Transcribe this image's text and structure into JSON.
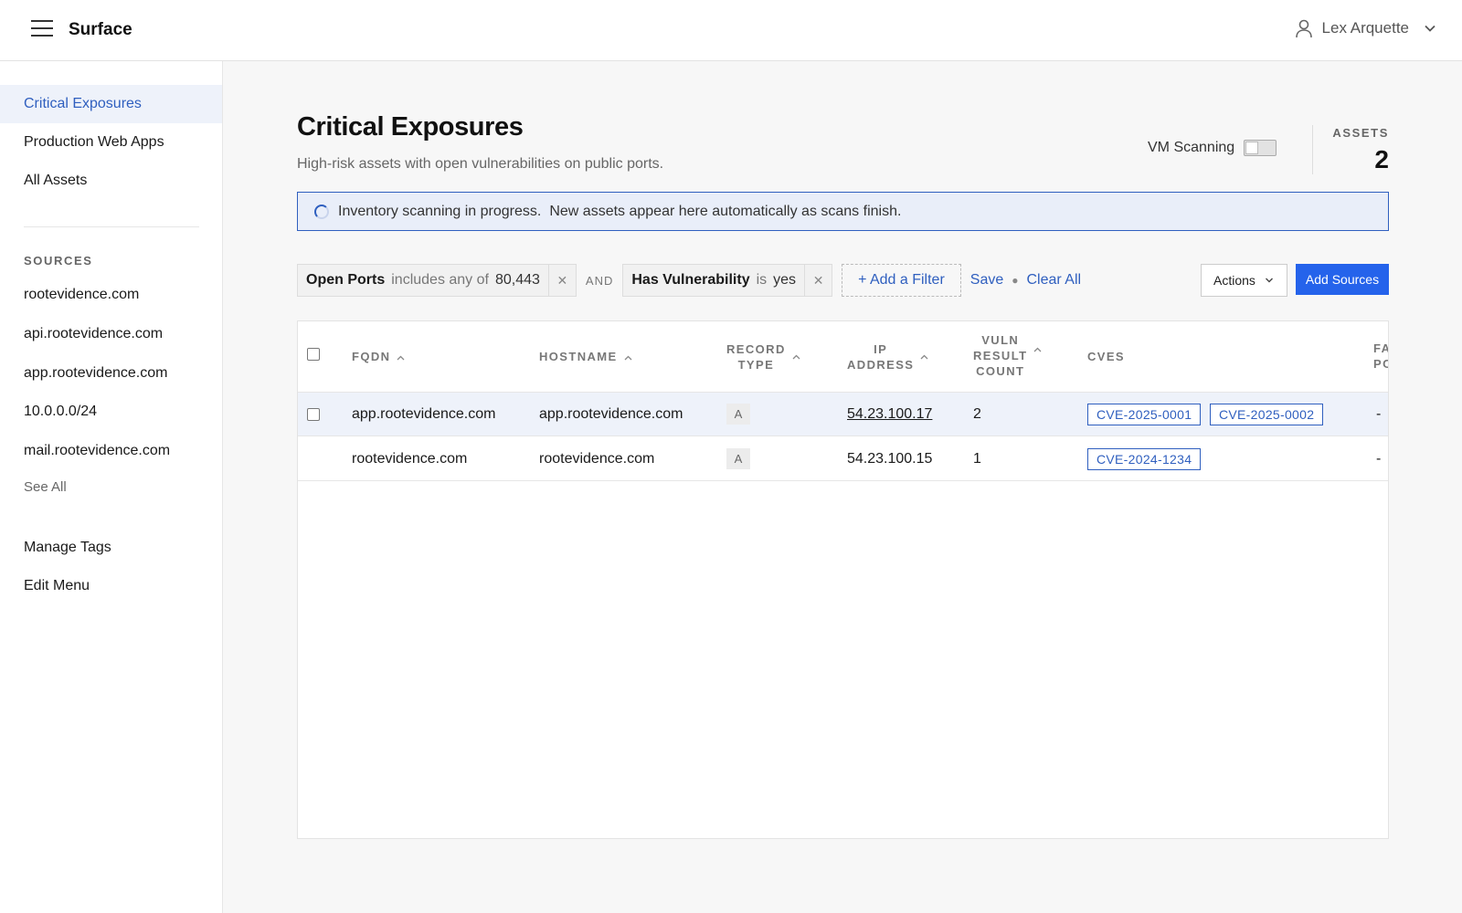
{
  "app": {
    "title": "Surface",
    "user_name": "Lex Arquette"
  },
  "sidebar": {
    "views": [
      {
        "label": "Critical Exposures",
        "active": true
      },
      {
        "label": "Production Web Apps",
        "active": false
      },
      {
        "label": "All Assets",
        "active": false
      }
    ],
    "sources_heading": "SOURCES",
    "sources": [
      "rootevidence.com",
      "api.rootevidence.com",
      "app.rootevidence.com",
      "10.0.0.0/24",
      "mail.rootevidence.com"
    ],
    "see_all": "See All",
    "footer": [
      "Manage Tags",
      "Edit Menu"
    ]
  },
  "page": {
    "title": "Critical Exposures",
    "subtitle": "High-risk assets with open vulnerabilities on public ports.",
    "vm_scanning_label": "VM Scanning",
    "vm_scanning_on": false,
    "assets_label": "ASSETS",
    "assets_count": "2"
  },
  "banner": {
    "part1": "Inventory scanning in progress.",
    "part2": "New assets appear here automatically as scans finish."
  },
  "filters": [
    {
      "field": "Open Ports",
      "op": "includes any of",
      "value": "80,443"
    },
    {
      "field": "Has Vulnerability",
      "op": "is",
      "value": "yes"
    }
  ],
  "filter_join": "AND",
  "filter_actions": {
    "add": "+ Add a Filter",
    "save": "Save",
    "clear": "Clear All"
  },
  "toolbar": {
    "actions": "Actions",
    "add_sources": "Add Sources"
  },
  "table": {
    "headers": {
      "fqdn": "FQDN",
      "hostname": "HOSTNAME",
      "record_type": [
        "RECORD",
        "TYPE"
      ],
      "ip_address": [
        "IP",
        "ADDRESS"
      ],
      "vuln_count": [
        "VULN",
        "RESULT",
        "COUNT"
      ],
      "cves": "CVES",
      "cut_off": [
        "FA",
        "PO"
      ]
    },
    "rows": [
      {
        "fqdn": "app.rootevidence.com",
        "hostname": "app.rootevidence.com",
        "record_type": "A",
        "ip": "54.23.100.17",
        "vuln_count": "2",
        "cves": [
          "CVE-2025-0001",
          "CVE-2025-0002"
        ],
        "extra": "-"
      },
      {
        "fqdn": "rootevidence.com",
        "hostname": "rootevidence.com",
        "record_type": "A",
        "ip": "54.23.100.15",
        "vuln_count": "1",
        "cves": [
          "CVE-2024-1234"
        ],
        "extra": "-"
      }
    ]
  },
  "colors": {
    "accent": "#2f5fbf",
    "primary_button": "#2563eb",
    "active_nav_bg": "#eef2fa"
  }
}
